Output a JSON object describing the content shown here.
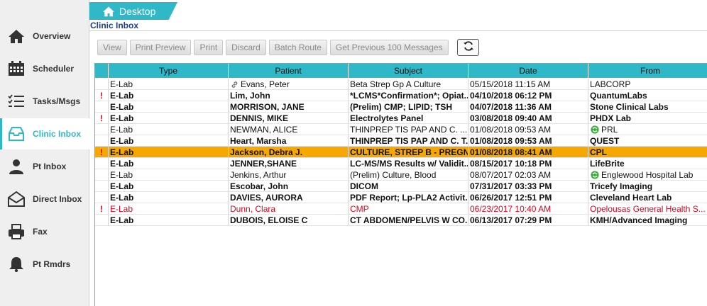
{
  "app": {
    "desktop_tab": "Desktop",
    "section_title": "Clinic Inbox",
    "accent_color": "#2fb8c8",
    "selected_row_color": "#f5a800"
  },
  "sidebar": {
    "items": [
      {
        "label": "Overview",
        "icon": "home-icon"
      },
      {
        "label": "Scheduler",
        "icon": "calendar-icon"
      },
      {
        "label": "Tasks/Msgs",
        "icon": "checklist-icon"
      },
      {
        "label": "Clinic Inbox",
        "icon": "inbox-tray-icon",
        "active": true
      },
      {
        "label": "Pt Inbox",
        "icon": "person-icon"
      },
      {
        "label": "Direct Inbox",
        "icon": "envelope-icon"
      },
      {
        "label": "Fax",
        "icon": "fax-icon"
      },
      {
        "label": "Pt Rmdrs",
        "icon": "bell-icon"
      }
    ]
  },
  "toolbar": {
    "buttons": [
      "View",
      "Print Preview",
      "Print",
      "Discard",
      "Batch Route",
      "Get Previous 100 Messages"
    ],
    "refresh_icon": "refresh-icon"
  },
  "table": {
    "columns": [
      "Type",
      "Patient",
      "Subject",
      "Date",
      "From"
    ],
    "rows": [
      {
        "flag": "",
        "type": "E-Lab",
        "patient": "Evans, Peter",
        "patient_icon": "link-icon",
        "subject": "Beta Strep Gp A Culture",
        "date": "05/15/2018 11:15 AM",
        "from": "LABCORP",
        "bold": false
      },
      {
        "flag": "!",
        "type": "E-Lab",
        "patient": "Lim, John",
        "subject": "*LCMS*Confirmation*; Opiat...",
        "date": "04/10/2018 06:12 PM",
        "from": "QuantumLabs",
        "bold": true
      },
      {
        "flag": "",
        "type": "E-Lab",
        "patient": "MORRISON, JANE",
        "subject": "(Prelim) CMP; LIPID; TSH",
        "date": "04/07/2018 11:36 AM",
        "from": "Stone Clinical Labs",
        "bold": true
      },
      {
        "flag": "!",
        "type": "E-Lab",
        "patient": "DENNIS, MIKE",
        "subject": "Electrolytes Panel",
        "date": "03/08/2018 09:40 AM",
        "from": "PHDX Lab",
        "bold": true
      },
      {
        "flag": "",
        "type": "E-Lab",
        "patient": "NEWMAN, ALICE",
        "subject": "THINPREP TIS PAP AND C. ...",
        "date": "01/08/2018 09:53 AM",
        "from": "PRL",
        "from_icon": "green-refresh-icon",
        "bold": false
      },
      {
        "flag": "",
        "type": "E-Lab",
        "patient": "Heart, Marsha",
        "subject": "THINPREP TIS PAP AND C. T...",
        "date": "01/08/2018 09:53 AM",
        "from": "QUEST",
        "bold": true
      },
      {
        "flag": "!",
        "type": "E-Lab",
        "patient": "Jackson, Debra J.",
        "subject": "CULTURE, STREP B - PREGN...",
        "date": "01/08/2018 08:41 AM",
        "from": "CPL",
        "bold": true,
        "selected": true
      },
      {
        "flag": "",
        "type": "E-Lab",
        "patient": "JENNER,SHANE",
        "subject": "LC-MS/MS Results w/ Validit...",
        "date": "08/15/2017 10:18 PM",
        "from": "LifeBrite",
        "bold": true
      },
      {
        "flag": "",
        "type": "E-Lab",
        "patient": "Jenkins, Arthur",
        "subject": "(Prelim) Culture, Blood",
        "date": "08/07/2017 02:03 AM",
        "from": "Englewood Hospital Lab",
        "from_icon": "green-refresh-icon",
        "bold": false
      },
      {
        "flag": "",
        "type": "E-Lab",
        "patient": "Escobar, John",
        "subject": "DICOM",
        "date": "07/31/2017 03:33 PM",
        "from": "Tricefy Imaging",
        "bold": true
      },
      {
        "flag": "",
        "type": "E-Lab",
        "patient": "DAVIES, AURORA",
        "subject": "PDF Report; Lp-PLA2 Activit...",
        "date": "06/26/2017 12:51 PM",
        "from": "Cleveland Heart Lab",
        "bold": true
      },
      {
        "flag": "!",
        "type": "E-Lab",
        "patient": "Dunn, Clara",
        "subject": "CMP",
        "date": "06/23/2017 10:40 AM",
        "from": "Opelousas General Health S...",
        "bold": false,
        "red": true
      },
      {
        "flag": "",
        "type": "E-Lab",
        "patient": "DUBOIS, ELOISE C",
        "subject": "CT ABDOMEN/PELVIS W CO...",
        "date": "06/13/2017 07:29 PM",
        "from": "KMH/Advanced Imaging",
        "bold": true
      }
    ]
  }
}
